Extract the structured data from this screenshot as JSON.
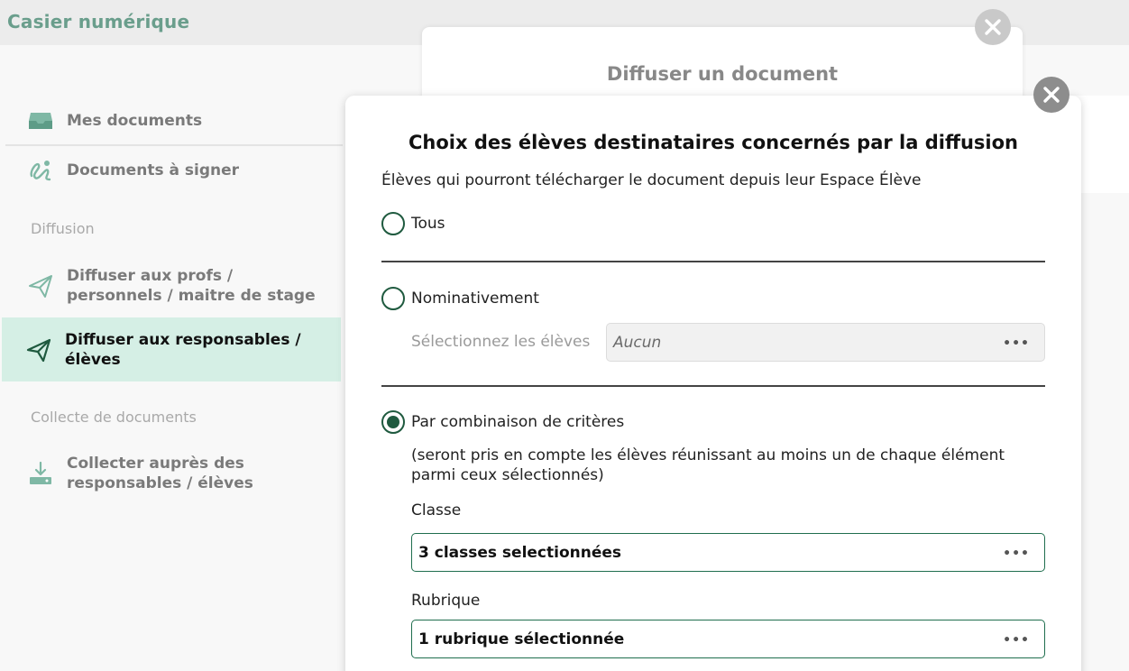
{
  "app": {
    "title": "Casier numérique"
  },
  "sidebar": {
    "items": [
      {
        "label": "Mes documents",
        "icon": "inbox-icon"
      },
      {
        "label": "Documents à signer",
        "icon": "signature-icon"
      }
    ],
    "sections": [
      {
        "label": "Diffusion",
        "items": [
          {
            "label": "Diffuser aux profs / personnels / maitre de stage",
            "icon": "send-icon"
          },
          {
            "label": "Diffuser aux responsables / élèves",
            "icon": "send-icon",
            "active": true
          }
        ]
      },
      {
        "label": "Collecte de documents",
        "items": [
          {
            "label": "Collecter auprès des responsables / élèves",
            "icon": "download-tray-icon"
          }
        ]
      }
    ]
  },
  "back_modal": {
    "title": "Diffuser un document"
  },
  "modal": {
    "title": "Choix des élèves destinataires concernés par la diffusion",
    "subtitle": "Élèves qui pourront télécharger le document depuis leur Espace Élève",
    "options": {
      "all": {
        "label": "Tous",
        "checked": false
      },
      "nominative": {
        "label": "Nominativement",
        "checked": false,
        "select_label": "Sélectionnez les élèves",
        "select_value": "Aucun"
      },
      "criteria": {
        "label": "Par combinaison de critères",
        "checked": true,
        "note": "(seront pris en compte les élèves réunissant au moins un de chaque élément parmi ceux sélectionnés)",
        "classe_label": "Classe",
        "classe_value": "3 classes selectionnées",
        "rubrique_label": "Rubrique",
        "rubrique_value": "1 rubrique sélectionnée"
      }
    },
    "more_glyph": "•••"
  },
  "colors": {
    "accent": "#1f5a3f",
    "active_bg": "#d5efe5",
    "app_title": "#6a9e8c"
  }
}
